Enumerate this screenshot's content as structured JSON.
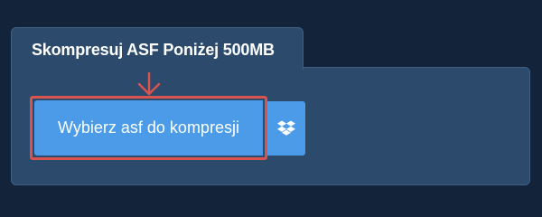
{
  "panel": {
    "title": "Skompresuj ASF Poniżej 500MB"
  },
  "upload": {
    "choose_label": "Wybierz asf do kompresji",
    "dropbox_icon": "dropbox-icon",
    "pointer_icon": "arrow-down-icon"
  },
  "colors": {
    "page_background": "#13233a",
    "panel_background": "#2c4a6b",
    "button": "#4c9be8",
    "highlight": "#d9534f"
  }
}
